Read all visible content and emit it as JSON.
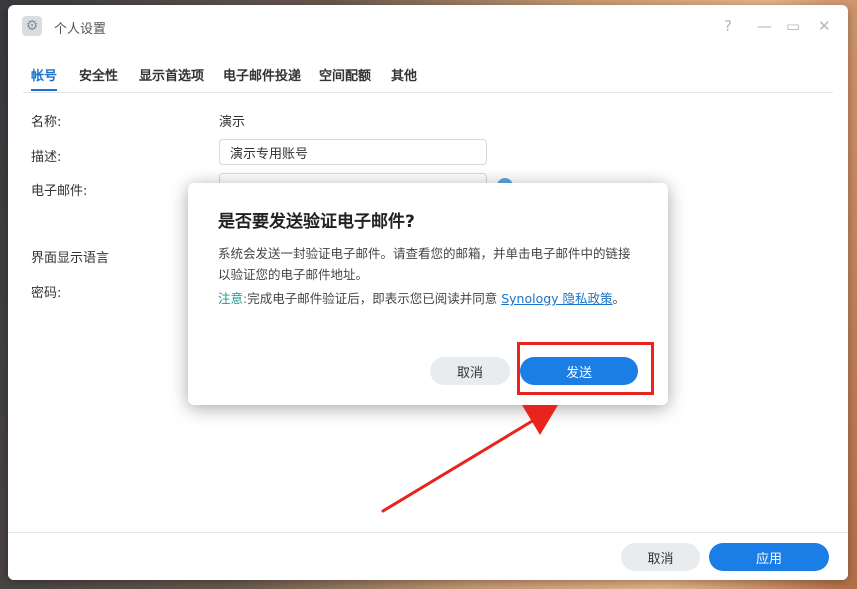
{
  "window": {
    "title": "个人设置",
    "app_icon": "settings-icon"
  },
  "window_controls": {
    "help": "?",
    "minimize": "—",
    "maximize": "▭",
    "close": "✕"
  },
  "tabs": [
    {
      "label": "帐号",
      "active": true
    },
    {
      "label": "安全性"
    },
    {
      "label": "显示首选项"
    },
    {
      "label": "电子邮件投递"
    },
    {
      "label": "空间配额"
    },
    {
      "label": "其他"
    }
  ],
  "form": {
    "name_label": "名称:",
    "name_value": "演示",
    "description_label": "描述:",
    "description_value": "演示专用账号",
    "email_label": "电子邮件:",
    "language_label": "界面显示语言",
    "password_label": "密码:"
  },
  "footer": {
    "cancel_label": "取消",
    "apply_label": "应用"
  },
  "dialog": {
    "title": "是否要发送验证电子邮件?",
    "body": "系统会发送一封验证电子邮件。请查看您的邮箱，并单击电子邮件中的链接以验证您的电子邮件地址。",
    "note_prefix": "注意:",
    "note_text": "完成电子邮件验证后，即表示您已阅读并同意 ",
    "note_link": "Synology 隐私政策",
    "note_suffix": "。",
    "cancel_label": "取消",
    "send_label": "发送"
  },
  "colors": {
    "accent": "#1a7ee6",
    "annotation": "#e8241d"
  }
}
